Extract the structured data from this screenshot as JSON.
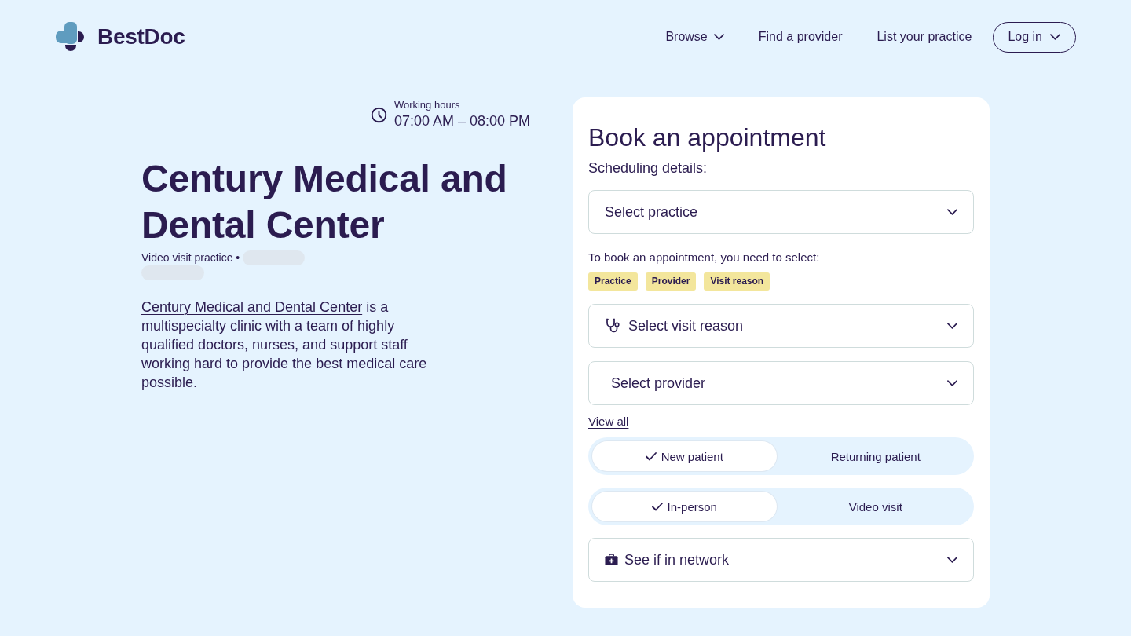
{
  "header": {
    "logo": {
      "text": "BestDoc"
    },
    "nav": [
      {
        "label": "Browse",
        "has_menu": true
      },
      {
        "label": "Find a provider",
        "has_menu": false
      },
      {
        "label": "List your practice",
        "has_menu": false
      }
    ],
    "login": {
      "label": "Log in"
    }
  },
  "practice": {
    "working_hours": {
      "label": "Working hours",
      "value": "07:00 AM – 08:00 PM"
    },
    "name": "Century Medical and Dental Center",
    "subtitle": "Video visit practice •",
    "location_loading": true,
    "description": {
      "link": "Century Medical and Dental Center",
      "text": "is a multispecialty clinic with a team of highly qualified doctors, nurses, and support staff working hard to provide the best medical care possible."
    }
  },
  "booking": {
    "title": "Book an appointment",
    "subtitle": "Scheduling details:",
    "practice_select": {
      "placeholder": "Select practice"
    },
    "requirement_note": "To book an appointment, you need to select:",
    "required_tags": [
      "Practice",
      "Provider",
      "Visit reason"
    ],
    "visit_reason_select": {
      "placeholder": "Select visit reason"
    },
    "provider_select": {
      "placeholder": "Select provider"
    },
    "view_all_link": "View all",
    "patient_type": [
      {
        "label": "New patient",
        "selected": true
      },
      {
        "label": "Returning patient",
        "selected": false
      }
    ],
    "visit_type": [
      {
        "label": "In-person",
        "selected": true
      },
      {
        "label": "Video visit",
        "selected": false
      }
    ],
    "network_select": {
      "placeholder": "See if in network"
    }
  }
}
